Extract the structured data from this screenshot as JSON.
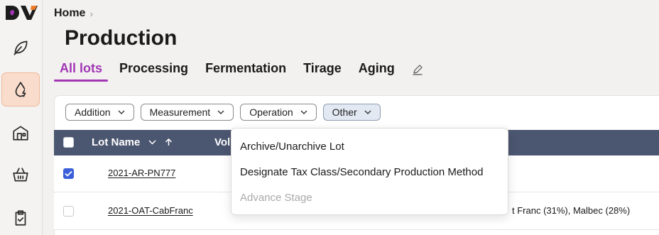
{
  "sidebar": {
    "logo_text": "DV",
    "items": [
      {
        "icon": "leaf-icon",
        "active": false
      },
      {
        "icon": "drop-icon",
        "active": true
      },
      {
        "icon": "building-icon",
        "active": false
      },
      {
        "icon": "basket-icon",
        "active": false
      },
      {
        "icon": "clipboard-icon",
        "active": false
      }
    ]
  },
  "breadcrumb": {
    "home": "Home",
    "separator": "›"
  },
  "page": {
    "title": "Production"
  },
  "tabs": [
    {
      "label": "All lots",
      "active": true
    },
    {
      "label": "Processing",
      "active": false
    },
    {
      "label": "Fermentation",
      "active": false
    },
    {
      "label": "Tirage",
      "active": false
    },
    {
      "label": "Aging",
      "active": false
    }
  ],
  "filters": [
    {
      "label": "Addition",
      "open": false
    },
    {
      "label": "Measurement",
      "open": false
    },
    {
      "label": "Operation",
      "open": false
    },
    {
      "label": "Other",
      "open": true
    }
  ],
  "table": {
    "headers": {
      "lot_name": "Lot Name",
      "volume": "Vol"
    },
    "rows": [
      {
        "lot": "2021-AR-PN777",
        "checked": true,
        "varietal": ""
      },
      {
        "lot": "2021-OAT-CabFranc",
        "checked": false,
        "varietal": "t Franc (31%), Malbec (28%)"
      }
    ]
  },
  "dropdown": {
    "items": [
      {
        "label": "Archive/Unarchive Lot",
        "disabled": false
      },
      {
        "label": "Designate Tax Class/Secondary Production Method",
        "disabled": false
      },
      {
        "label": "Advance Stage",
        "disabled": true
      }
    ]
  },
  "colors": {
    "accent": "#a236b5",
    "table_header": "#4b5670",
    "active_nav_bg": "#f9dccc",
    "checkbox_checked": "#3b5fd9"
  }
}
